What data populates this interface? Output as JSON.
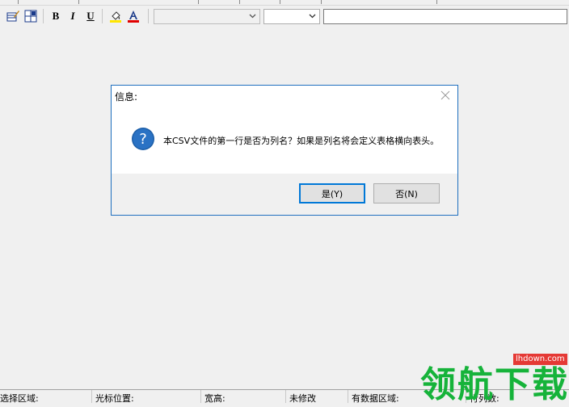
{
  "toolbar": {
    "bold_label": "B",
    "italic_label": "I",
    "underline_label": "U",
    "font_name_value": "",
    "font_size_value": "",
    "text_value": ""
  },
  "dialog": {
    "title": "信息:",
    "message": "本CSV文件的第一行是否为列名？如果是列名将会定义表格横向表头。",
    "yes_label": "是(Y)",
    "no_label": "否(N)"
  },
  "statusbar": {
    "selection": "选择区域:",
    "cursor": "光标位置:",
    "size": "宽高:",
    "modified": "未修改",
    "data_region": "有数据区域:",
    "rows_cols": "行列数:"
  },
  "watermark": {
    "brand": "领航下载",
    "url": "lhdown.com"
  },
  "colors": {
    "accent": "#0078d7",
    "dialog_border": "#1f6fbf",
    "watermark_green": "#16b33a",
    "watermark_red": "#e53935"
  }
}
